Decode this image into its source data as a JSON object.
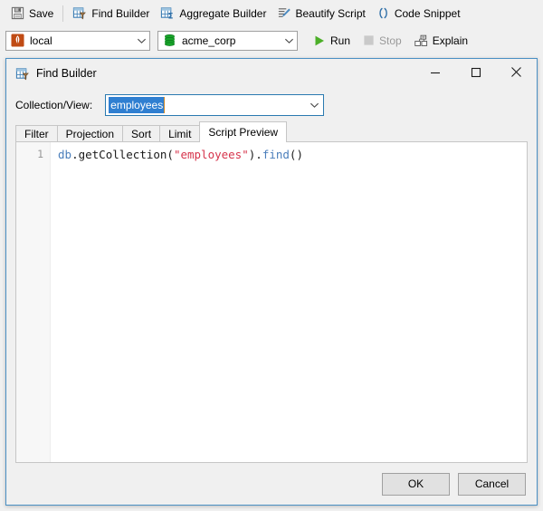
{
  "app": {
    "toolbar": {
      "items": [
        {
          "label": "Save",
          "icon": "save-floppy-icon",
          "name": "save"
        },
        {
          "label": "Find Builder",
          "icon": "find-builder-grid-icon",
          "name": "find-builder"
        },
        {
          "label": "Aggregate Builder",
          "icon": "aggregate-builder-sigma-icon",
          "name": "aggregate-builder"
        },
        {
          "label": "Beautify Script",
          "icon": "beautify-pen-icon",
          "name": "beautify-script"
        },
        {
          "label": "Code Snippet",
          "icon": "code-snippet-parens-icon",
          "name": "code-snippet"
        }
      ]
    },
    "connection_bar": {
      "connection": {
        "value": "local",
        "icon": "mongodb-leaf-icon"
      },
      "database": {
        "value": "acme_corp",
        "icon": "database-cylinder-icon"
      },
      "run": {
        "label": "Run",
        "icon": "play-triangle-icon",
        "enabled": true
      },
      "stop": {
        "label": "Stop",
        "icon": "stop-square-icon",
        "enabled": false
      },
      "explain": {
        "label": "Explain",
        "icon": "explain-diagram-icon",
        "enabled": true
      }
    }
  },
  "dialog": {
    "title": "Find Builder",
    "title_icon": "find-builder-grid-icon",
    "window_controls": {
      "minimize": "—",
      "maximize": "☐",
      "close": "✕"
    },
    "collection_field": {
      "label": "Collection/View:",
      "value": "employees",
      "selected": true
    },
    "tabs": [
      {
        "label": "Filter",
        "active": false
      },
      {
        "label": "Projection",
        "active": false
      },
      {
        "label": "Sort",
        "active": false
      },
      {
        "label": "Limit",
        "active": false
      },
      {
        "label": "Script Preview",
        "active": true
      }
    ],
    "editor": {
      "line_number": "1",
      "tokens": [
        {
          "text": "db",
          "type": "object"
        },
        {
          "text": ".getCollection(",
          "type": "plain"
        },
        {
          "text": "\"employees\"",
          "type": "string"
        },
        {
          "text": ").",
          "type": "plain"
        },
        {
          "text": "find",
          "type": "function"
        },
        {
          "text": "()",
          "type": "plain"
        }
      ],
      "full_text": "db.getCollection(\"employees\").find()"
    },
    "footer": {
      "ok_label": "OK",
      "cancel_label": "Cancel"
    }
  },
  "colors": {
    "accent_blue": "#4a90c4",
    "selection_blue": "#2f7fd1",
    "mongo_green": "#00a74a",
    "mongo_orange": "#c04b14",
    "run_green": "#4caf28",
    "string_red": "#d6344c",
    "code_blue": "#4a7ebb"
  }
}
